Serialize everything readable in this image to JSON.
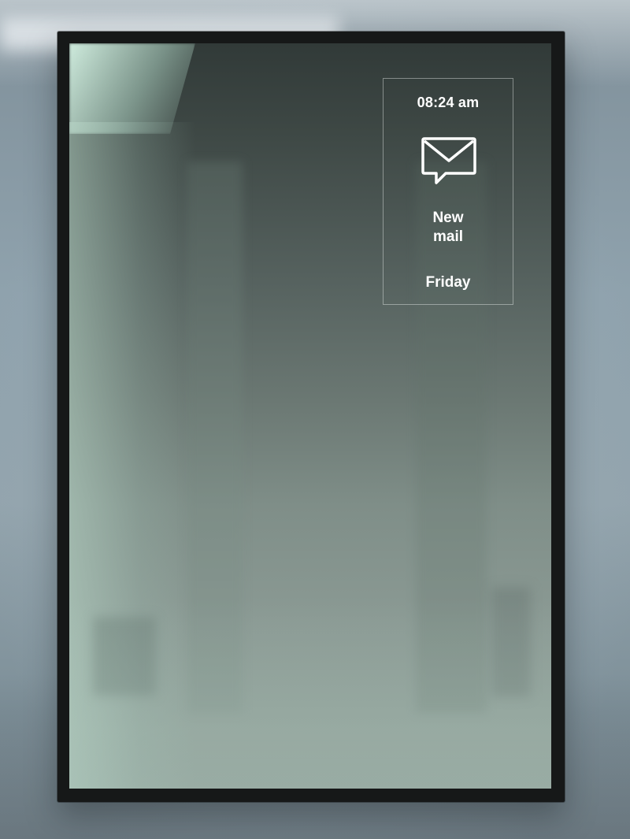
{
  "widget": {
    "time": "08:24 am",
    "notification_icon": "envelope-icon",
    "notification_line1": "New",
    "notification_line2": "mail",
    "day": "Friday"
  },
  "colors": {
    "frame": "#161818",
    "glass_top": "#313a38",
    "glass_bottom": "#909f98",
    "text": "#ffffff"
  }
}
